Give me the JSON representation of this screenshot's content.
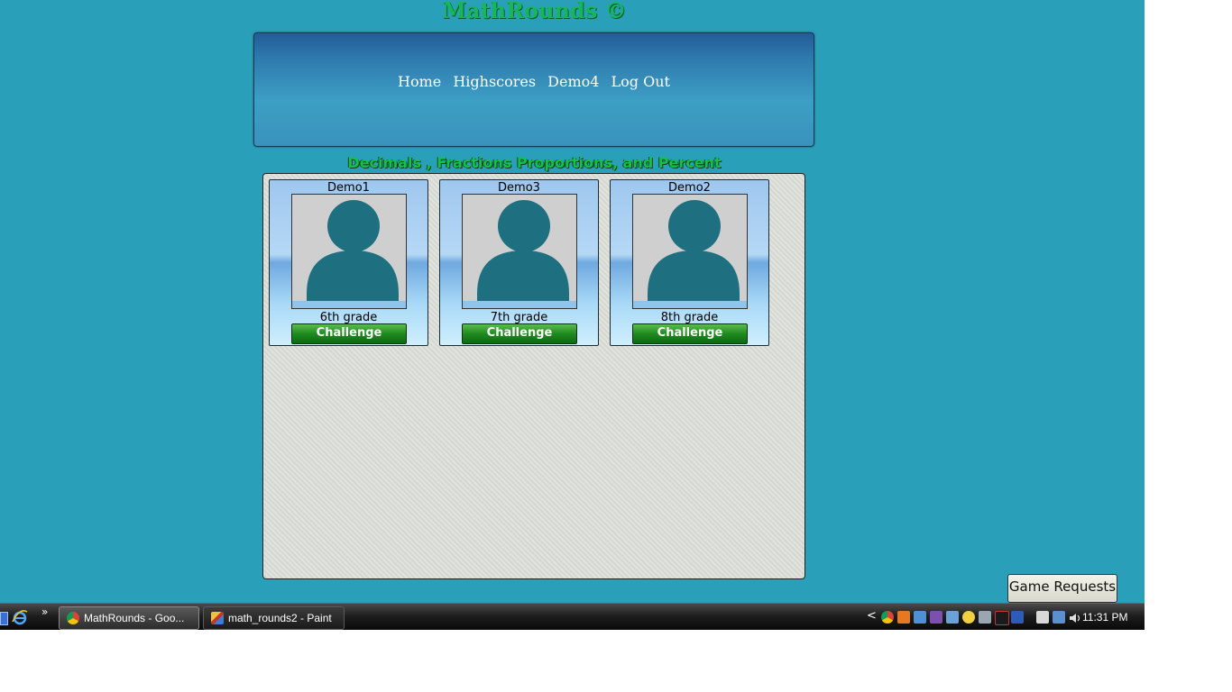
{
  "site": {
    "title": "MathRounds ©"
  },
  "nav": {
    "links": [
      "Home",
      "Highscores",
      "Demo4",
      "Log Out"
    ]
  },
  "category": {
    "title": "Decimals , Fractions Proportions, and Percent"
  },
  "players": [
    {
      "name": "Demo1",
      "grade": "6th grade",
      "button": "Challenge"
    },
    {
      "name": "Demo3",
      "grade": "7th grade",
      "button": "Challenge"
    },
    {
      "name": "Demo2",
      "grade": "8th grade",
      "button": "Challenge"
    }
  ],
  "game_requests": {
    "label": "Game Requests"
  },
  "taskbar": {
    "items": [
      {
        "label": "MathRounds - Goo...",
        "icon": "chrome-icon",
        "active": true
      },
      {
        "label": "math_rounds2 - Paint",
        "icon": "paint-icon",
        "active": false
      }
    ],
    "overflow": "»",
    "tray_chevron": "<",
    "clock": "11:31 PM"
  },
  "colors": {
    "background": "#2a9fba",
    "title_green": "#14b85a",
    "avatar": "#1e7080",
    "button_green": "#1f8a1f"
  }
}
